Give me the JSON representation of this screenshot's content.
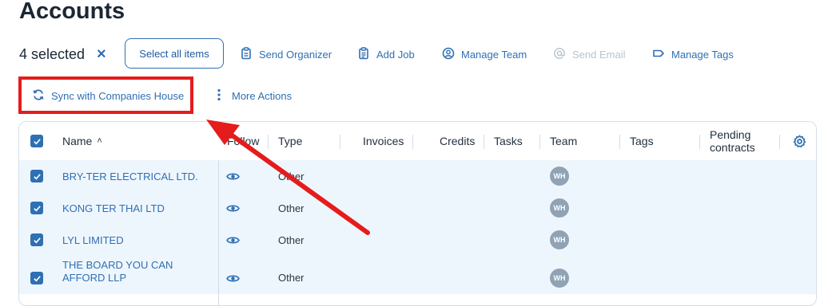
{
  "page": {
    "title": "Accounts"
  },
  "selection": {
    "count_label": "4 selected",
    "clear_symbol": "×",
    "select_all_label": "Select all items"
  },
  "actions": [
    {
      "label": "Send Organizer",
      "icon": "clipboard-icon",
      "disabled": false
    },
    {
      "label": "Add Job",
      "icon": "clipboard-list-icon",
      "disabled": false
    },
    {
      "label": "Manage Team",
      "icon": "user-circle-icon",
      "disabled": false
    },
    {
      "label": "Send Email",
      "icon": "at-sign-icon",
      "disabled": true
    },
    {
      "label": "Manage Tags",
      "icon": "tag-icon",
      "disabled": false
    },
    {
      "label": "Sync with Companies House",
      "icon": "sync-icon",
      "disabled": false
    },
    {
      "label": "More Actions",
      "icon": "more-vertical-icon",
      "disabled": false
    }
  ],
  "table": {
    "columns": [
      "Name",
      "Follow",
      "Type",
      "Invoices",
      "Credits",
      "Tasks",
      "Team",
      "Tags",
      "Pending contracts"
    ],
    "sort_indicator": "˄",
    "rows": [
      {
        "name": "BRY-TER ELECTRICAL LTD.",
        "type": "Other",
        "team": "WH",
        "checked": true
      },
      {
        "name": "KONG TER THAI LTD",
        "type": "Other",
        "team": "WH",
        "checked": true
      },
      {
        "name": "LYL LIMITED",
        "type": "Other",
        "team": "WH",
        "checked": true
      },
      {
        "name": "THE BOARD YOU CAN AFFORD LLP",
        "type": "Other",
        "team": "WH",
        "checked": true
      }
    ]
  },
  "colors": {
    "accent": "#2f6fb3",
    "highlight": "#e51c1c",
    "row_bg": "#eef6fd",
    "avatar_bg": "#8fa3b5"
  }
}
